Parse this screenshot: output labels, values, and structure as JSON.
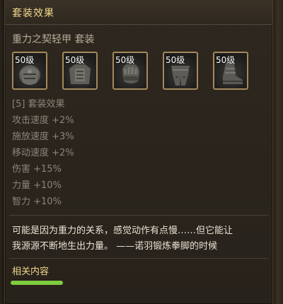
{
  "header": {
    "title": "套装效果"
  },
  "set_name": "重力之契轻甲 套装",
  "items": [
    {
      "level": "50级",
      "icon": "armor-piece-icon"
    },
    {
      "level": "50级",
      "icon": "chest-armor-icon"
    },
    {
      "level": "50级",
      "icon": "gauntlet-icon"
    },
    {
      "level": "50级",
      "icon": "leg-armor-icon"
    },
    {
      "level": "50级",
      "icon": "boot-icon"
    }
  ],
  "set_effect_heading": "[5] 套装效果",
  "stats": [
    "攻击速度 +2%",
    "施放速度 +3%",
    "移动速度 +2%",
    "伤害 +15%",
    "力量 +10%",
    "智力 +10%"
  ],
  "flavor": {
    "line1": "可能是因为重力的关系，感觉动作有点慢……但它能让",
    "line2": "我源源不断地生出力量。 ——诺羽锻炼拳脚的时候"
  },
  "related": {
    "label": "相关内容"
  },
  "colors": {
    "title_gold": "#f1d98d",
    "stat_gray": "#8b8478",
    "flavor_white": "#e9e2d4",
    "item_border": "#a4895a",
    "progress_green": "#7fcc3f"
  }
}
